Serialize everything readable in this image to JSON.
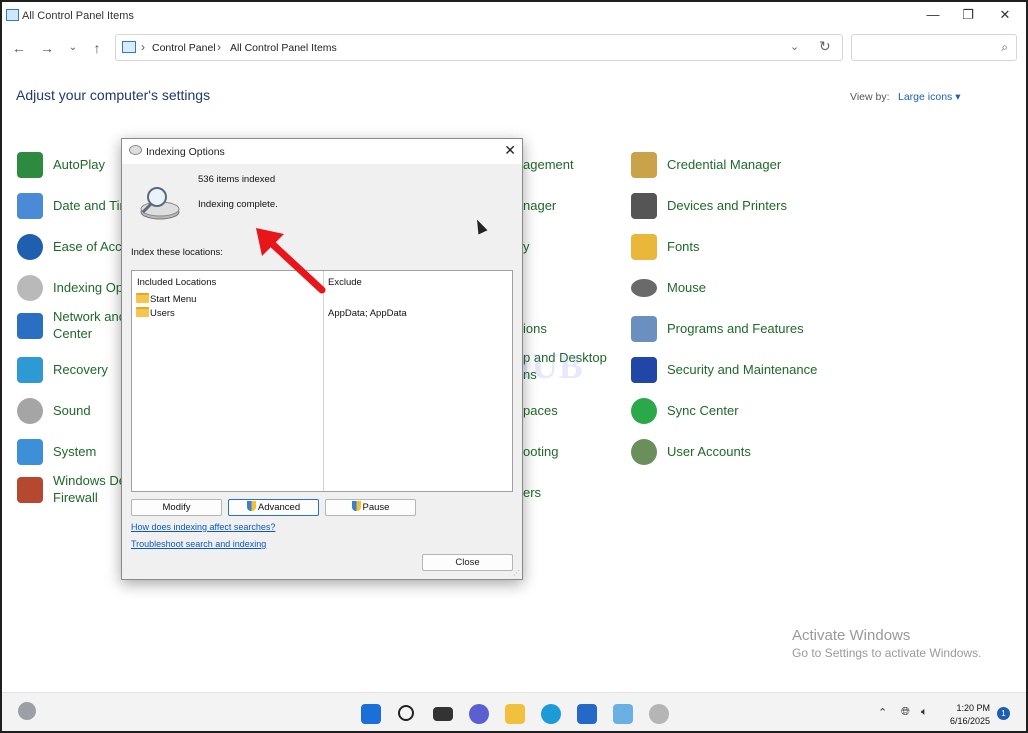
{
  "window": {
    "title": "All Control Panel Items"
  },
  "address": {
    "crumbs": [
      "Control Panel",
      "All Control Panel Items"
    ],
    "search_placeholder": ""
  },
  "header": {
    "heading": "Adjust your computer's settings",
    "view_by_label": "View by:",
    "view_by_value": "Large icons"
  },
  "items_left": [
    "AutoPlay",
    "Date and Tir",
    "Ease of Acce",
    "Indexing Op",
    "Network anc",
    "Center",
    "Recovery",
    "Sound",
    "System",
    "Windows De",
    "Firewall"
  ],
  "items_middle": [
    "agement",
    "nager",
    "y",
    "ions",
    "p and Desktop",
    "ns",
    "paces",
    "ooting",
    "ers"
  ],
  "items_right": [
    "Credential Manager",
    "Devices and Printers",
    "Fonts",
    "Mouse",
    "Programs and Features",
    "Security and Maintenance",
    "Sync Center",
    "User Accounts"
  ],
  "dialog": {
    "title": "Indexing Options",
    "count": "536 items indexed",
    "status": "Indexing complete.",
    "locations_label": "Index these locations:",
    "col_included": "Included Locations",
    "col_exclude": "Exclude",
    "locations": [
      "Start Menu",
      "Users"
    ],
    "exclude_value": "AppData; AppData",
    "btn_modify": "Modify",
    "btn_advanced": "Advanced",
    "btn_pause": "Pause",
    "link_how": "How does indexing affect searches?",
    "link_troubleshoot": "Troubleshoot search and indexing",
    "btn_close": "Close"
  },
  "watermark": "IT Pros HUB",
  "activation": {
    "line1": "Activate Windows",
    "line2": "Go to Settings to activate Windows."
  },
  "taskbar": {
    "time": "1:20 PM",
    "date": "6/16/2025",
    "notifications": "1"
  }
}
